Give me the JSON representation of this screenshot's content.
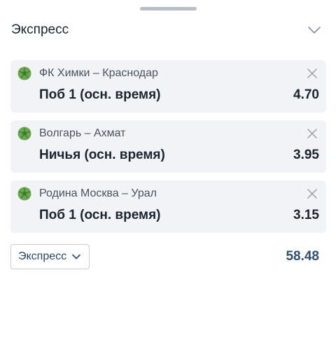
{
  "header": {
    "title": "Экспресс"
  },
  "bets": [
    {
      "match": "ФК Химки – Краснодар",
      "market": "Поб 1 (осн. время)",
      "odds": "4.70"
    },
    {
      "match": "Волгарь – Ахмат",
      "market": "Ничья (осн. время)",
      "odds": "3.95"
    },
    {
      "match": "Родина Москва – Урал",
      "market": "Поб 1 (осн. время)",
      "odds": "3.15"
    }
  ],
  "footer": {
    "bet_type": "Экспресс",
    "total_odds": "58.48"
  },
  "icons": {
    "sport": "football-icon",
    "remove": "close-icon",
    "collapse": "chevron-down-icon",
    "dropdown": "chevron-down-icon"
  },
  "colors": {
    "ball": "#6aa84f",
    "total": "#2d4f73",
    "card_bg": "#f1f3f6"
  }
}
